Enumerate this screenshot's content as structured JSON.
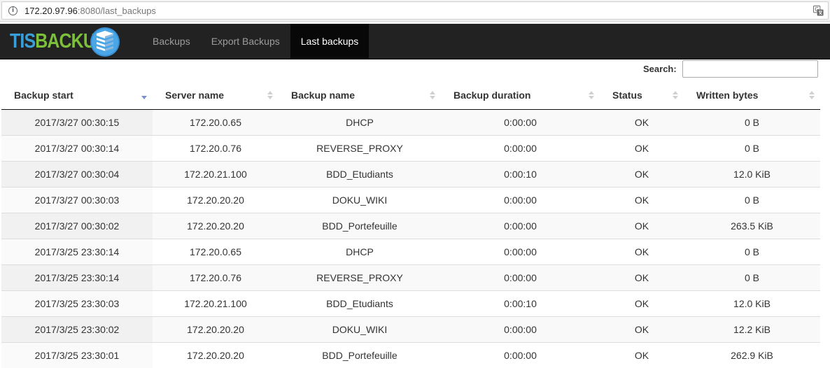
{
  "browser": {
    "url_host": "172.20.97.96",
    "url_rest": ":8080/last_backups"
  },
  "brand": {
    "part1": "TIS",
    "part2": "BACKUP"
  },
  "nav": [
    {
      "label": "Backups",
      "active": false
    },
    {
      "label": "Export Backups",
      "active": false
    },
    {
      "label": "Last backups",
      "active": true
    }
  ],
  "search": {
    "label": "Search:",
    "value": ""
  },
  "table": {
    "columns": [
      "Backup start",
      "Server name",
      "Backup name",
      "Backup duration",
      "Status",
      "Written bytes"
    ],
    "sorted_column": "Backup start",
    "sort_direction": "descending",
    "rows": [
      [
        "2017/3/27 00:30:15",
        "172.20.0.65",
        "DHCP",
        "0:00:00",
        "OK",
        "0 B"
      ],
      [
        "2017/3/27 00:30:14",
        "172.20.0.76",
        "REVERSE_PROXY",
        "0:00:00",
        "OK",
        "0 B"
      ],
      [
        "2017/3/27 00:30:04",
        "172.20.21.100",
        "BDD_Etudiants",
        "0:00:10",
        "OK",
        "12.0 KiB"
      ],
      [
        "2017/3/27 00:30:03",
        "172.20.20.20",
        "DOKU_WIKI",
        "0:00:00",
        "OK",
        "0 B"
      ],
      [
        "2017/3/27 00:30:02",
        "172.20.20.20",
        "BDD_Portefeuille",
        "0:00:00",
        "OK",
        "263.5 KiB"
      ],
      [
        "2017/3/25 23:30:14",
        "172.20.0.65",
        "DHCP",
        "0:00:00",
        "OK",
        "0 B"
      ],
      [
        "2017/3/25 23:30:14",
        "172.20.0.76",
        "REVERSE_PROXY",
        "0:00:00",
        "OK",
        "0 B"
      ],
      [
        "2017/3/25 23:30:03",
        "172.20.21.100",
        "BDD_Etudiants",
        "0:00:10",
        "OK",
        "12.0 KiB"
      ],
      [
        "2017/3/25 23:30:02",
        "172.20.20.20",
        "DOKU_WIKI",
        "0:00:00",
        "OK",
        "12.2 KiB"
      ],
      [
        "2017/3/25 23:30:01",
        "172.20.20.20",
        "BDD_Portefeuille",
        "0:00:00",
        "OK",
        "262.9 KiB"
      ]
    ]
  },
  "colors": {
    "navbar": "#222222",
    "nav_active": "#080808",
    "brand_tis": "#3a9fd8",
    "brand_backup": "#7cbf3a",
    "sort_active": "#7a8fcf",
    "sort_inactive": "#d0d0d0"
  },
  "icons": {
    "address": "info-icon",
    "translate": "translate-icon",
    "logo": "stacked-disks-logo-icon",
    "sort": "sort-icon"
  }
}
